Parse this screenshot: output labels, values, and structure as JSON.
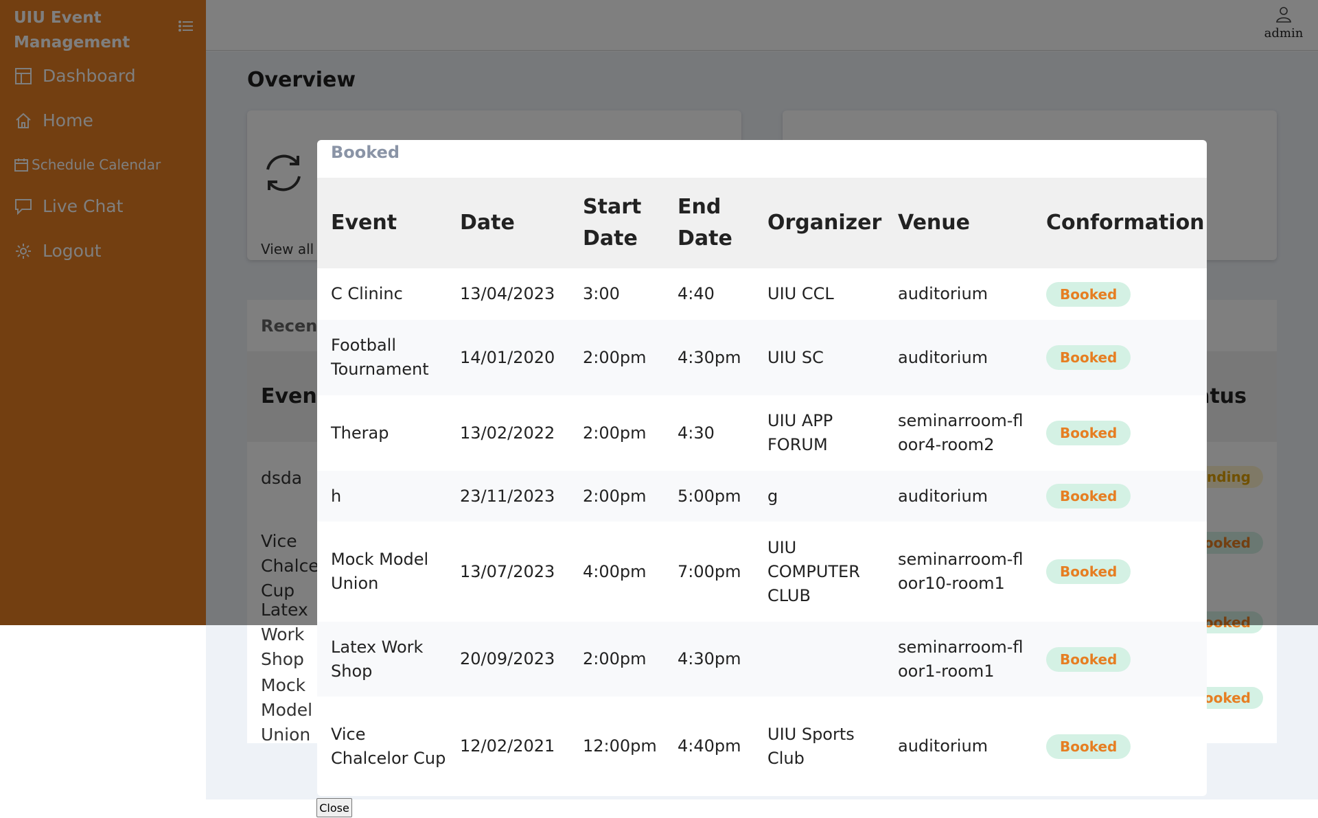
{
  "sidebar": {
    "brand": "UIU Event Management",
    "items": [
      {
        "label": "Dashboard",
        "icon": "dashboard-icon"
      },
      {
        "label": "Home",
        "icon": "home-icon"
      },
      {
        "label": "Schedule Calendar",
        "icon": "calendar-icon"
      },
      {
        "label": "Live Chat",
        "icon": "chat-icon"
      },
      {
        "label": "Logout",
        "icon": "gear-icon"
      }
    ]
  },
  "topbar": {
    "user_label": "admin"
  },
  "main": {
    "overview_title": "Overview",
    "card_view_all": "View all",
    "recent_title": "Recent",
    "recent_header_event": "Event",
    "recent_header_status": "Status",
    "recent_rows": [
      {
        "event": "dsda",
        "status": "Pending"
      },
      {
        "event": "Vice Chalcelor Cup",
        "status": "Booked"
      },
      {
        "event": "Latex Work Shop",
        "status": "Booked"
      },
      {
        "event": "Mock Model Union",
        "status": "Booked"
      }
    ]
  },
  "modal": {
    "title": "Booked",
    "columns": [
      "Event",
      "Date",
      "Start Date",
      "End Date",
      "Organizer",
      "Venue",
      "Conformation"
    ],
    "rows": [
      {
        "event": "C Clininc",
        "date": "13/04/2023",
        "start": "3:00",
        "end": "4:40",
        "organizer": "UIU CCL",
        "venue": "auditorium",
        "status": "Booked"
      },
      {
        "event": "Football Tournament",
        "date": "14/01/2020",
        "start": "2:00pm",
        "end": "4:30pm",
        "organizer": "UIU SC",
        "venue": "auditorium",
        "status": "Booked"
      },
      {
        "event": "Therap",
        "date": "13/02/2022",
        "start": "2:00pm",
        "end": "4:30",
        "organizer": "UIU APP FORUM",
        "venue": "seminarroom-floor4-room2",
        "status": "Booked"
      },
      {
        "event": "h",
        "date": "23/11/2023",
        "start": "2:00pm",
        "end": "5:00pm",
        "organizer": "g",
        "venue": "auditorium",
        "status": "Booked"
      },
      {
        "event": "Mock Model Union",
        "date": "13/07/2023",
        "start": "4:00pm",
        "end": "7:00pm",
        "organizer": "UIU COMPUTER CLUB",
        "venue": "seminarroom-floor10-room1",
        "status": "Booked"
      },
      {
        "event": "Latex Work Shop",
        "date": "20/09/2023",
        "start": "2:00pm",
        "end": "4:30pm",
        "organizer": "",
        "venue": "seminarroom-floor1-room1",
        "status": "Booked"
      },
      {
        "event": "Vice Chalcelor Cup",
        "date": "12/02/2021",
        "start": "12:00pm",
        "end": "4:40pm",
        "organizer": "UIU Sports Club",
        "venue": "auditorium",
        "status": "Booked"
      }
    ],
    "close_label": "Close"
  }
}
